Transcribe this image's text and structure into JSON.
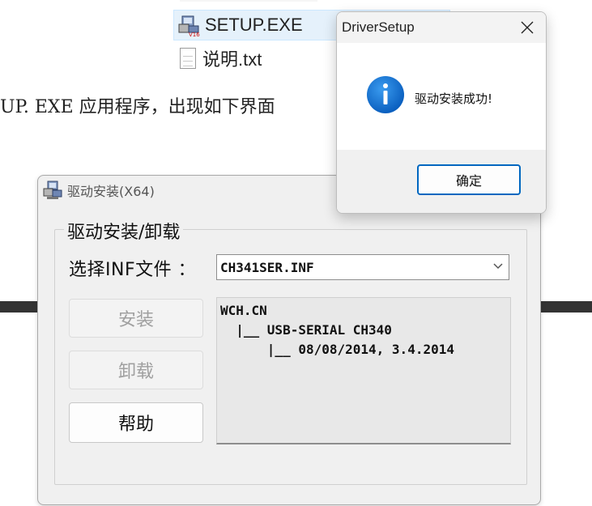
{
  "explorer": {
    "files": [
      {
        "name": "SETUP.EXE",
        "icon": "setup-exe-icon"
      },
      {
        "name": "说明.txt",
        "icon": "text-file-icon"
      }
    ]
  },
  "document": {
    "text_fragment": "UP. EXE 应用程序，出现如下界面"
  },
  "driver_window": {
    "title": "驱动安装(X64)",
    "group_label": "驱动安装/卸载",
    "inf_label": "选择INF文件 ：",
    "inf_selected": "CH341SER.INF",
    "buttons": {
      "install": "安装",
      "uninstall": "卸载",
      "help": "帮助"
    },
    "info_lines": [
      "WCH.CN",
      "  |__ USB-SERIAL CH340",
      "      |__ 08/08/2014, 3.4.2014"
    ]
  },
  "dialog": {
    "title": "DriverSetup",
    "message": "驱动安装成功!",
    "ok_label": "确定",
    "icon": "info-icon",
    "accent_color": "#0067c0"
  }
}
